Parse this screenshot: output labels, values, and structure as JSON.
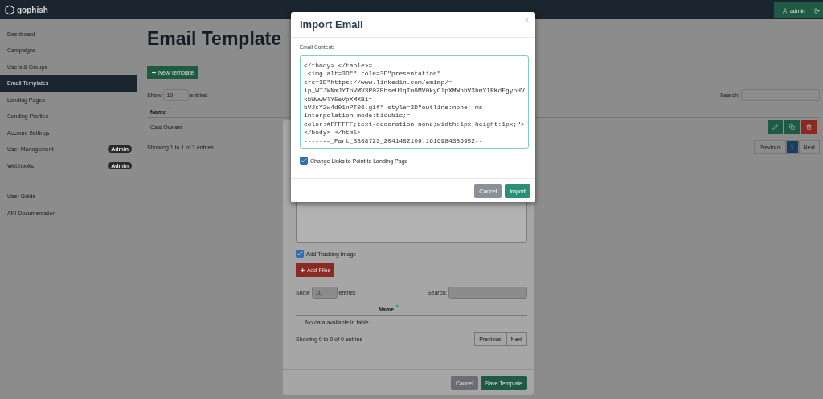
{
  "navbar": {
    "brand": "gophish",
    "user": "admin"
  },
  "sidebar": {
    "items": [
      {
        "label": "Dashboard",
        "selected": false
      },
      {
        "label": "Campaigns",
        "selected": false
      },
      {
        "label": "Users & Groups",
        "selected": false
      },
      {
        "label": "Email Templates",
        "selected": true
      },
      {
        "label": "Landing Pages",
        "selected": false
      },
      {
        "label": "Sending Profiles",
        "selected": false
      },
      {
        "label": "Account Settings",
        "selected": false
      },
      {
        "label": "User Management",
        "selected": false,
        "badge": "Admin"
      },
      {
        "label": "Webhooks",
        "selected": false,
        "badge": "Admin"
      }
    ],
    "links": [
      {
        "label": "User Guide"
      },
      {
        "label": "API Documentation"
      }
    ]
  },
  "page": {
    "title": "Email Template",
    "new_button": "New Template",
    "show_label": "Show",
    "page_size": "10",
    "entries_label": "entries",
    "search_label": "Search:",
    "columns": [
      "Name"
    ],
    "rows": [
      {
        "name": "Cats Owners"
      }
    ],
    "info": "Showing 1 to 1 of 1 entries",
    "pagination": [
      {
        "label": "Previous",
        "selected": false
      },
      {
        "label": "1",
        "selected": true
      },
      {
        "label": "Next",
        "selected": false
      }
    ]
  },
  "template_modal": {
    "tracking": {
      "label": "Add Tracking Image",
      "checked": true
    },
    "add_files": "Add Files",
    "show_label": "Show",
    "page_size": "10",
    "entries_label": "entries",
    "search_label": "Search:",
    "columns": [
      "Name"
    ],
    "empty": "No data available in table",
    "info": "Showing 0 to 0 of 0 entries",
    "pagination": [
      {
        "label": "Previous",
        "selected": false
      },
      {
        "label": "Next",
        "selected": false
      }
    ],
    "buttons": [
      {
        "label": "Cancel",
        "kind": "cancel"
      },
      {
        "label": "Save Template",
        "kind": "primary"
      }
    ]
  },
  "import_modal": {
    "title": "Import Email",
    "close": "×",
    "field_label": "Email Content:",
    "content_lines": [
      "</tbody> </table>=",
      " <img alt=3D\"\" role=3D\"presentation\"",
      "src=3D\"https://www.linkedin.com/emimp/=",
      "ip_WTJWNmJYTnVMV3R0ZEhseU1qTm9MV0kyOlpXMWhhV3hmYlRKdFgybHV",
      "kbWwwWlY5eVpXMXBi=",
      "bVJsY2w4d01nPT06.gif\" style=3D\"outline:none;-ms-",
      "interpolation-mode:bicubic;=",
      "color:#FFFFFF;text-decoration:none;width:1px;height:1px;\">",
      "</body> </html>",
      "------=_Part_3888723_2041482109.1616984386952--"
    ],
    "change_links": {
      "label": "Change Links to Point to Landing Page",
      "checked": true
    },
    "buttons": [
      {
        "label": "Cancel",
        "kind": "cancel"
      },
      {
        "label": "Import",
        "kind": "primary"
      }
    ]
  }
}
